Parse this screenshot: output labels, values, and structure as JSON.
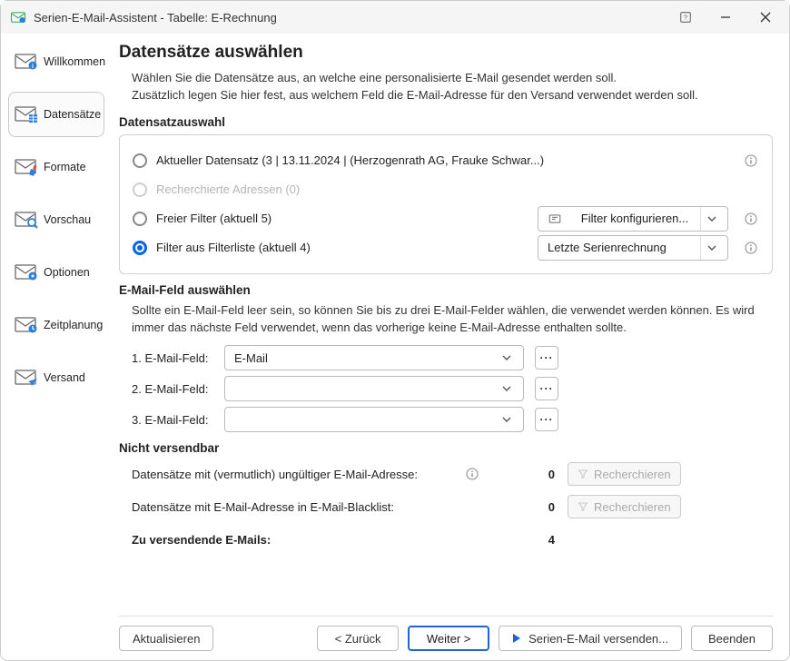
{
  "window": {
    "title": "Serien-E-Mail-Assistent - Tabelle: E-Rechnung"
  },
  "sidebar": {
    "items": [
      {
        "label": "Willkommen"
      },
      {
        "label": "Datensätze"
      },
      {
        "label": "Formate"
      },
      {
        "label": "Vorschau"
      },
      {
        "label": "Optionen"
      },
      {
        "label": "Zeitplanung"
      },
      {
        "label": "Versand"
      }
    ]
  },
  "page": {
    "title": "Datensätze auswählen",
    "intro1": "Wählen Sie die Datensätze aus, an welche eine personalisierte E-Mail gesendet werden soll.",
    "intro2": "Zusätzlich legen Sie hier fest, aus welchem Feld die E-Mail-Adresse für den Versand verwendet werden soll."
  },
  "datensatzauswahl": {
    "heading": "Datensatzauswahl",
    "opt_current": "Aktueller Datensatz (3 | 13.11.2024 | (Herzogenrath AG, Frauke Schwar...)",
    "opt_recherchiert": "Recherchierte Adressen (0)",
    "opt_freier_filter": "Freier Filter (aktuell 5)",
    "opt_filterliste": "Filter aus Filterliste (aktuell 4)",
    "filter_config_label": "Filter konfigurieren...",
    "filterliste_selected": "Letzte Serienrechnung"
  },
  "emailfeld": {
    "heading": "E-Mail-Feld auswählen",
    "desc": "Sollte ein E-Mail-Feld leer sein, so können Sie bis zu drei E-Mail-Felder wählen, die verwendet werden können. Es wird immer das nächste Feld verwendet, wenn das vorherige keine E-Mail-Adresse enthalten sollte.",
    "label1": "1. E-Mail-Feld:",
    "label2": "2. E-Mail-Feld:",
    "label3": "3. E-Mail-Feld:",
    "value1": "E-Mail",
    "value2": "",
    "value3": ""
  },
  "nichtversendbar": {
    "heading": "Nicht versendbar",
    "row_invalid_label": "Datensätze mit (vermutlich) ungültiger E-Mail-Adresse:",
    "row_invalid_count": "0",
    "row_blacklist_label": "Datensätze mit E-Mail-Adresse in E-Mail-Blacklist:",
    "row_blacklist_count": "0",
    "recherchieren": "Recherchieren",
    "total_label": "Zu versendende E-Mails:",
    "total_value": "4"
  },
  "footer": {
    "refresh": "Aktualisieren",
    "back": "< Zurück",
    "next": "Weiter >",
    "send": "Serien-E-Mail versenden...",
    "close": "Beenden"
  }
}
